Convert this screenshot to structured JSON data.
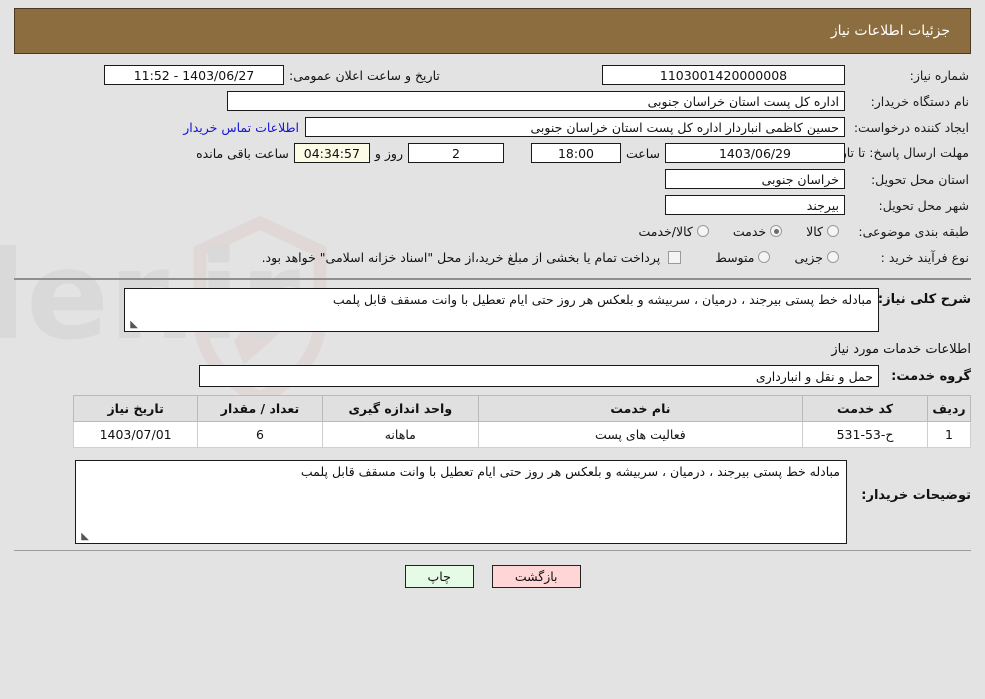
{
  "header": {
    "title": "جزئیات اطلاعات نیاز",
    "bg_color": "#8c6d40"
  },
  "form": {
    "need_number_label": "شماره نیاز:",
    "need_number_value": "1103001420000008",
    "announce_label": "تاریخ و ساعت اعلان عمومی:",
    "announce_value": "1403/06/27 - 11:52",
    "buyer_org_label": "نام دستگاه خریدار:",
    "buyer_org_value": "اداره کل پست استان خراسان جنوبی",
    "requester_label": "ایجاد کننده درخواست:",
    "requester_value": "حسین کاظمی انباردار اداره کل پست استان خراسان جنوبی",
    "contact_link": "اطلاعات تماس خریدار",
    "deadline_label": "مهلت ارسال پاسخ: تا تاریخ:",
    "deadline_date": "1403/06/29",
    "hour_label": "ساعت",
    "hour_value": "18:00",
    "days_value": "2",
    "days_label": "روز و",
    "countdown_value": "04:34:57",
    "countdown_label": "ساعت باقی مانده",
    "province_label": "استان محل تحویل:",
    "province_value": "خراسان جنوبی",
    "city_label": "شهر محل تحویل:",
    "city_value": "بیرجند",
    "category_label": "طبقه بندی موضوعی:",
    "category_options": [
      {
        "label": "کالا",
        "selected": false
      },
      {
        "label": "خدمت",
        "selected": true
      },
      {
        "label": "کالا/خدمت",
        "selected": false
      }
    ],
    "process_label": "نوع فرآیند خرید :",
    "process_options": [
      {
        "label": "جزیی",
        "selected": false
      },
      {
        "label": "متوسط",
        "selected": false
      }
    ],
    "treasury_checked": false,
    "treasury_note": "پرداخت تمام یا بخشی از مبلغ خرید،از محل \"اسناد خزانه اسلامی\" خواهد بود."
  },
  "summary": {
    "label": "شرح کلی نیاز:",
    "value": "مبادله خط پستی بیرجند ، درمیان ، سربیشه و بلعکس هر روز حتی ایام تعطیل با وانت مسقف قابل پلمب"
  },
  "services": {
    "subhead": "اطلاعات خدمات مورد نیاز",
    "group_label": "گروه خدمت:",
    "group_value": "حمل و نقل و انبارداری",
    "table": {
      "columns": [
        "ردیف",
        "کد خدمت",
        "نام خدمت",
        "واحد اندازه گیری",
        "تعداد / مقدار",
        "تاریخ نیاز"
      ],
      "rows": [
        [
          "1",
          "ح-53-531",
          "فعالیت های پست",
          "ماهانه",
          "6",
          "1403/07/01"
        ]
      ]
    }
  },
  "buyer_notes": {
    "label": "توضیحات خریدار:",
    "value": "مبادله خط پستی بیرجند ، درمیان ، سربیشه و بلعکس هر روز حتی ایام تعطیل با وانت مسقف قابل پلمب"
  },
  "footer": {
    "back_label": "بازگشت",
    "print_label": "چاپ"
  }
}
